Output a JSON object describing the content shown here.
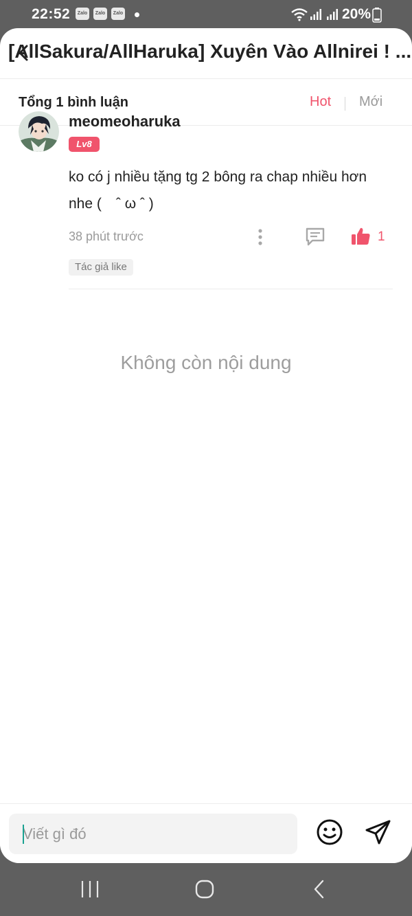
{
  "status_bar": {
    "time": "22:52",
    "notification_icons": [
      "Zalo",
      "Zalo",
      "Zalo"
    ],
    "battery": "20%",
    "icons": [
      "wifi-icon",
      "signal-icon",
      "signal-icon",
      "battery-icon"
    ]
  },
  "header": {
    "title": "[AllSakura/AllHaruka] Xuyên Vào Allnirei ! ...",
    "back_icon": "back-arrow-icon"
  },
  "sortbar": {
    "total": "Tổng 1 bình luận",
    "hot_label": "Hot",
    "new_label": "Mới",
    "active": "Hot"
  },
  "comments": [
    {
      "username": "meomeoharuka",
      "level": "Lv8",
      "text": "ko có j nhiều tặng tg 2 bông ra chap nhiều hơn nhe (　ˆ ω ˆ )",
      "time": "38 phút trước",
      "likes": "1",
      "author_badge": "Tác giả like"
    }
  ],
  "end_message": "Không còn nội dung",
  "input": {
    "placeholder": "Viết gì đó",
    "value": ""
  },
  "colors": {
    "accent": "#f0546c",
    "muted": "#9a9a9a",
    "system_bar": "#5f5f5f"
  },
  "nav_bar": {
    "buttons": [
      "recent-apps-icon",
      "home-icon",
      "back-icon"
    ]
  }
}
